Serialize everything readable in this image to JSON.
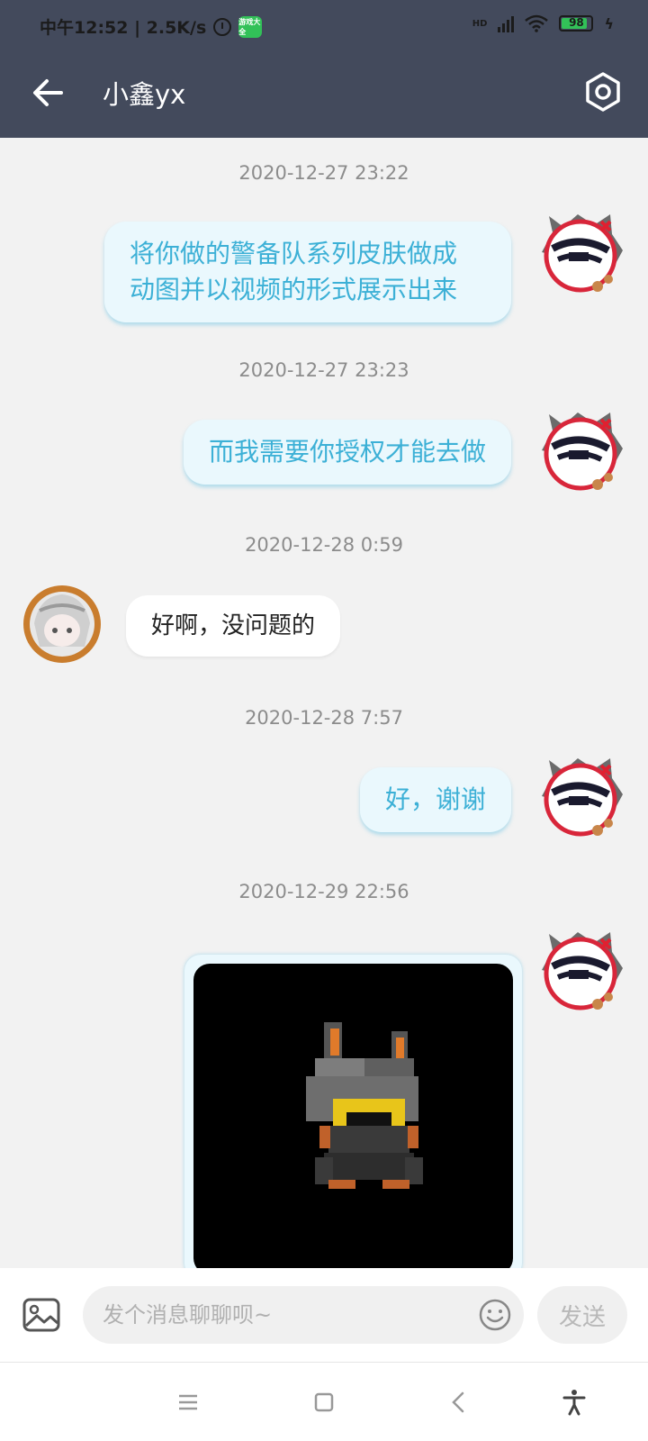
{
  "status_bar": {
    "left_text": "中午12:52 | 2.5K/s",
    "app_badge": "游戏大全",
    "network": "HD",
    "battery": "98"
  },
  "header": {
    "title": "小鑫yx",
    "back_icon": "back-arrow-icon",
    "settings_icon": "settings-hexagon-icon"
  },
  "messages": [
    {
      "time": "2020-12-27 23:22",
      "side": "out",
      "text_lines": [
        "将你做的警备队系列皮肤做成",
        "动图并以视频的形式展示出来"
      ]
    },
    {
      "time": "2020-12-27 23:23",
      "side": "out",
      "text": "而我需要你授权才能去做"
    },
    {
      "time": "2020-12-28 0:59",
      "side": "in",
      "text": "好啊，没问题的"
    },
    {
      "time": "2020-12-28 7:57",
      "side": "out",
      "text": "好，谢谢"
    },
    {
      "time": "2020-12-29 22:56",
      "side": "out",
      "type": "image",
      "image": "pixel-character-image"
    }
  ],
  "input_bar": {
    "placeholder": "发个消息聊聊呗~",
    "value": "",
    "send_label": "发送",
    "image_icon": "image-icon",
    "emoji_icon": "emoji-icon"
  },
  "system_nav": {
    "items": [
      "menu-icon",
      "home-icon",
      "back-icon",
      "accessibility-icon"
    ]
  },
  "colors": {
    "header_bg": "#434a5c",
    "outgoing_bubble_bg": "#eaf8fd",
    "outgoing_text": "#3cb0d6",
    "chat_bg": "#f2f2f2"
  }
}
